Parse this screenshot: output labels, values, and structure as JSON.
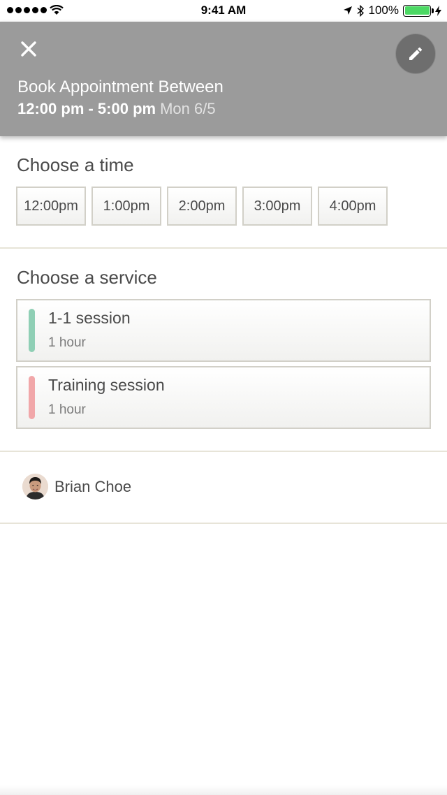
{
  "status_bar": {
    "time": "9:41 AM",
    "battery_text": "100%",
    "battery_level": 1.0,
    "battery_color": "#4cd964"
  },
  "header": {
    "close_icon": "close-icon",
    "edit_icon": "pencil-icon",
    "title": "Book Appointment Between",
    "time_range": "12:00 pm - 5:00 pm",
    "date": "Mon 6/5",
    "background": "#9b9b9b"
  },
  "time_section": {
    "title": "Choose a time",
    "slots": [
      "12:00pm",
      "1:00pm",
      "2:00pm",
      "3:00pm",
      "4:00pm"
    ]
  },
  "service_section": {
    "title": "Choose a service",
    "services": [
      {
        "name": "1-1 session",
        "duration": "1 hour",
        "color": "#8fcfb5"
      },
      {
        "name": "Training session",
        "duration": "1 hour",
        "color": "#f1a7a9"
      }
    ]
  },
  "staff": {
    "name": "Brian Choe"
  }
}
